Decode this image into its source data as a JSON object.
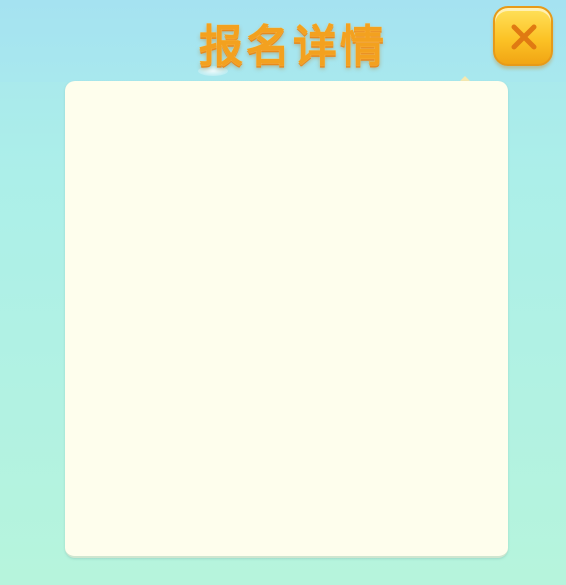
{
  "dialog": {
    "title": "报名详情",
    "close_icon": "close-x-icon",
    "colors": {
      "title": "#f3a11f",
      "background": "#acefe9",
      "panel": "#fefeed",
      "close_button": "#fcc326",
      "close_x": "#e07a12"
    }
  },
  "content": {
    "items": []
  }
}
